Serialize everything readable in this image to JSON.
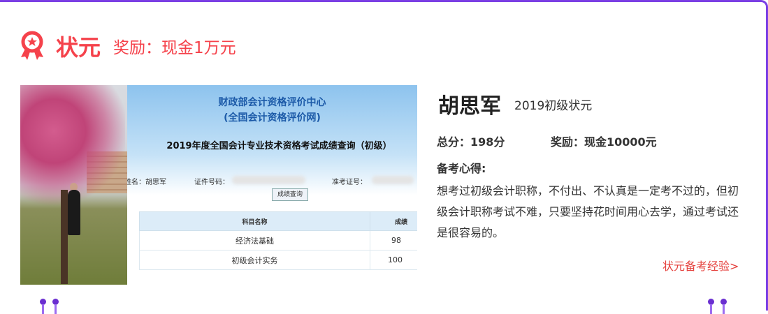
{
  "header": {
    "rank": "状元",
    "reward": "奖励：现金1万元"
  },
  "screenshot": {
    "org": "财政部会计资格评价中心",
    "site": "(全国会计资格评价网)",
    "query_title": "2019年度全国会计专业技术资格考试成绩查询（初级）",
    "name_field": "姓名：胡思军",
    "id_label": "证件号码：",
    "ticket_label": "准考证号：",
    "query_button": "成绩查询",
    "table": {
      "headers": [
        "科目名称",
        "成绩"
      ],
      "rows": [
        [
          "经济法基础",
          "98"
        ],
        [
          "初级会计实务",
          "100"
        ]
      ]
    }
  },
  "winner": {
    "name": "胡思军",
    "title": "2019初级状元",
    "total": "总分：198分",
    "prize": "奖励：现金10000元",
    "tips_label": "备考心得:",
    "tips": "想考过初级会计职称，不付出、不认真是一定考不过的，但初级会计职称考试不难，只要坚持花时间用心去学，通过考试还是很容易的。",
    "more_link": "状元备考经验>"
  },
  "colors": {
    "accent": "#f5424b",
    "border": "#7b3fe4"
  }
}
